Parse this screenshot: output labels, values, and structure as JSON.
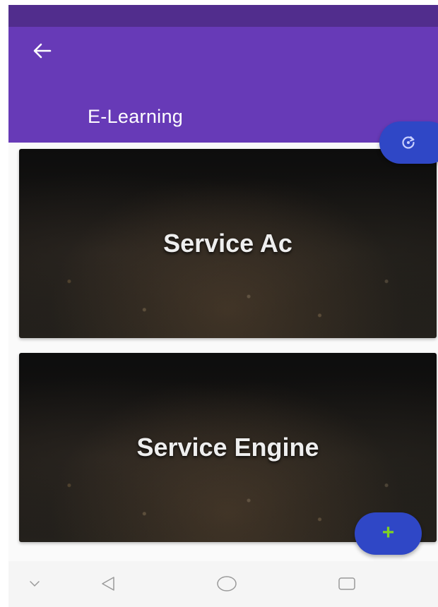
{
  "app_bar": {
    "title": "E-Learning",
    "back_icon": "arrow-back-icon",
    "color": "#673ab7",
    "status_bar_color": "#512d8d"
  },
  "fabs": {
    "refresh_icon": "refresh-icon",
    "add_icon": "plus-icon",
    "add_label": "+",
    "color": "#2f47c6",
    "plus_color": "#7fd321"
  },
  "cards": [
    {
      "label": "Service Ac"
    },
    {
      "label": "Service Engine"
    }
  ],
  "nav_bar": {
    "icons": [
      "chevron-down-icon",
      "back-triangle-icon",
      "home-circle-icon",
      "recents-square-icon"
    ]
  }
}
